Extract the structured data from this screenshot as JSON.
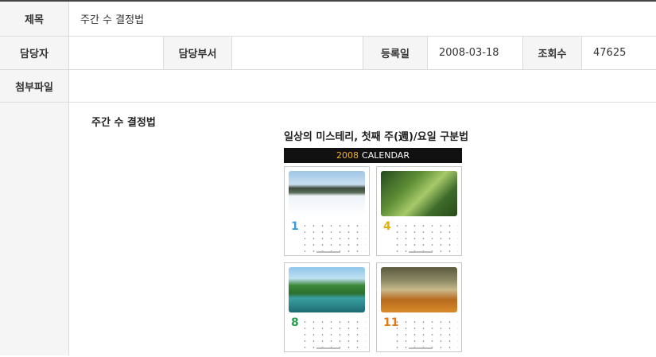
{
  "post": {
    "title_label": "제목",
    "title_value": "주간 수 결정법",
    "author_label": "담당자",
    "author_value": "",
    "dept_label": "담당부서",
    "dept_value": "",
    "date_label": "등록일",
    "date_value": "2008-03-18",
    "views_label": "조회수",
    "views_value": "47625",
    "attach_label": "첨부파일",
    "attach_value": ""
  },
  "content": {
    "heading": "주간 수 결정법",
    "article_title": "일상의 미스테리, 첫째 주(週)/요일 구분법",
    "banner_year": "2008",
    "banner_text": "CALENDAR",
    "months": [
      "1",
      "4",
      "8",
      "11"
    ],
    "month_colors": [
      "#3d9ad6",
      "#e0b000",
      "#22a04a",
      "#e07a1a"
    ]
  }
}
